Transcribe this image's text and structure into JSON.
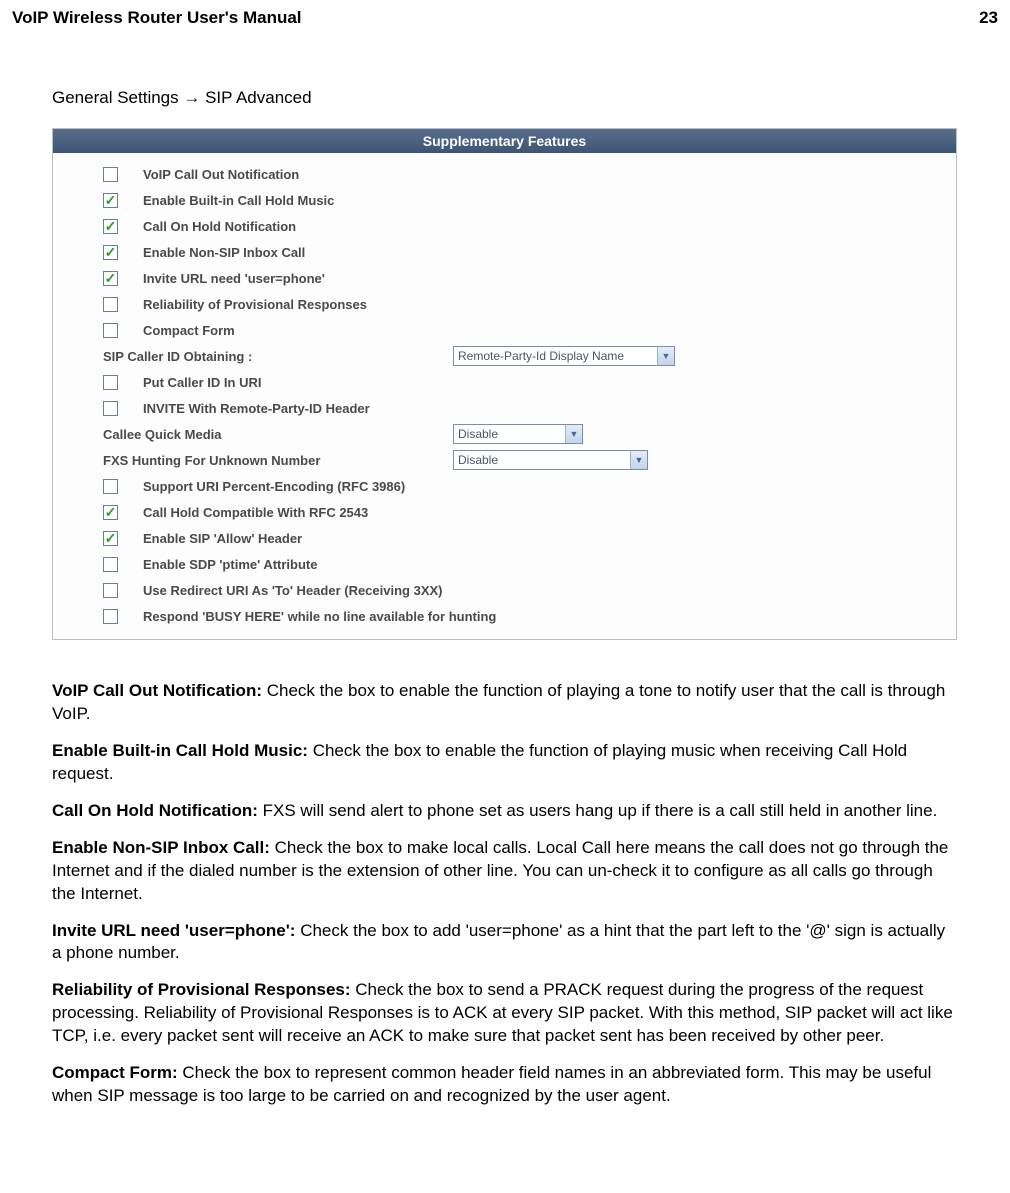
{
  "page": {
    "header_title": "VoIP Wireless Router User's Manual",
    "page_number": "23"
  },
  "breadcrumb": "General Settings  →  SIP Advanced",
  "panel": {
    "title": "Supplementary Features",
    "rows": {
      "voip_call_out": {
        "checked": false,
        "label": "VoIP Call Out Notification"
      },
      "hold_music": {
        "checked": true,
        "label": "Enable Built-in Call Hold Music"
      },
      "hold_notify": {
        "checked": true,
        "label": "Call On Hold Notification"
      },
      "non_sip_inbox": {
        "checked": true,
        "label": "Enable Non-SIP Inbox Call"
      },
      "invite_url": {
        "checked": true,
        "label": "Invite URL need 'user=phone'"
      },
      "prov_reliability": {
        "checked": false,
        "label": "Reliability of Provisional Responses"
      },
      "compact_form": {
        "checked": false,
        "label": "Compact Form"
      },
      "sip_caller_id": {
        "label": "SIP Caller ID Obtaining :",
        "value": "Remote-Party-Id Display Name"
      },
      "put_cid_uri": {
        "checked": false,
        "label": "Put Caller ID In URI"
      },
      "invite_rpid": {
        "checked": false,
        "label": "INVITE With Remote-Party-ID Header"
      },
      "callee_quick": {
        "label": "Callee Quick Media",
        "value": "Disable"
      },
      "fxs_hunting": {
        "label": "FXS Hunting For Unknown Number",
        "value": "Disable"
      },
      "uri_percent": {
        "checked": false,
        "label": "Support URI Percent-Encoding (RFC 3986)"
      },
      "call_hold_2543": {
        "checked": true,
        "label": "Call Hold Compatible With RFC 2543"
      },
      "sip_allow": {
        "checked": true,
        "label": "Enable SIP 'Allow' Header"
      },
      "sdp_ptime": {
        "checked": false,
        "label": "Enable SDP 'ptime' Attribute"
      },
      "redirect_uri_to": {
        "checked": false,
        "label": "Use Redirect URI As 'To' Header (Receiving 3XX)"
      },
      "respond_busy": {
        "checked": false,
        "label": "Respond 'BUSY HERE' while no line available for hunting"
      }
    }
  },
  "descriptions": {
    "d1": {
      "term": "VoIP Call Out Notification:",
      "body": " Check the box to enable the function of playing a tone to notify user that the call is through VoIP."
    },
    "d2": {
      "term": "Enable Built-in Call Hold Music:",
      "body": " Check the box to enable the function of playing music when receiving Call Hold request."
    },
    "d3": {
      "term": "Call On Hold Notification:",
      "body": " FXS will send alert to phone set as users hang up if there is a call still held in another line."
    },
    "d4": {
      "term": "Enable Non-SIP Inbox Call:",
      "body": " Check the box to make local calls. Local Call here means the call does not go through the Internet and if the dialed number is the extension of other line. You can un-check it to configure as all calls go through the Internet."
    },
    "d5": {
      "term": "Invite URL need 'user=phone':",
      "body": " Check the box to add 'user=phone' as a hint that the part left to the '@' sign is actually a phone number."
    },
    "d6": {
      "term": "Reliability of Provisional Responses:",
      "body": " Check the box to send a PRACK request during the progress of the request processing. Reliability of Provisional Responses is to ACK at every SIP packet. With this method, SIP packet will act like TCP, i.e. every packet sent will receive an ACK to make sure that packet sent has been received by other peer."
    },
    "d7": {
      "term": "Compact Form:",
      "body": " Check the box to represent common header field names in an abbreviated form. This may be useful when SIP message is too large to be carried on and recognized by the user agent."
    }
  }
}
